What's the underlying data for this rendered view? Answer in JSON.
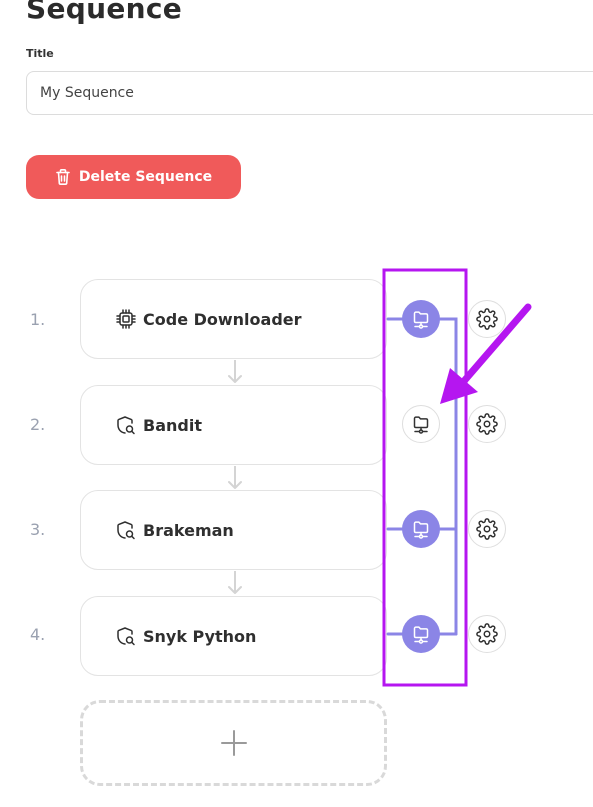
{
  "page": {
    "title": "Sequence"
  },
  "form": {
    "title_label": "Title",
    "title_value": "My Sequence"
  },
  "actions": {
    "delete_label": "Delete Sequence"
  },
  "colors": {
    "accent": "#8b85e6",
    "danger": "#f05a5a",
    "highlight": "#b516f0",
    "muted": "#9aa1b0"
  },
  "steps": [
    {
      "number": "1.",
      "name": "Code Downloader",
      "icon": "chip-icon",
      "node_active": true
    },
    {
      "number": "2.",
      "name": "Bandit",
      "icon": "scan-icon",
      "node_active": false
    },
    {
      "number": "3.",
      "name": "Brakeman",
      "icon": "scan-icon",
      "node_active": true
    },
    {
      "number": "4.",
      "name": "Snyk Python",
      "icon": "scan-icon",
      "node_active": true
    }
  ],
  "add_step": {
    "icon": "plus-icon"
  }
}
